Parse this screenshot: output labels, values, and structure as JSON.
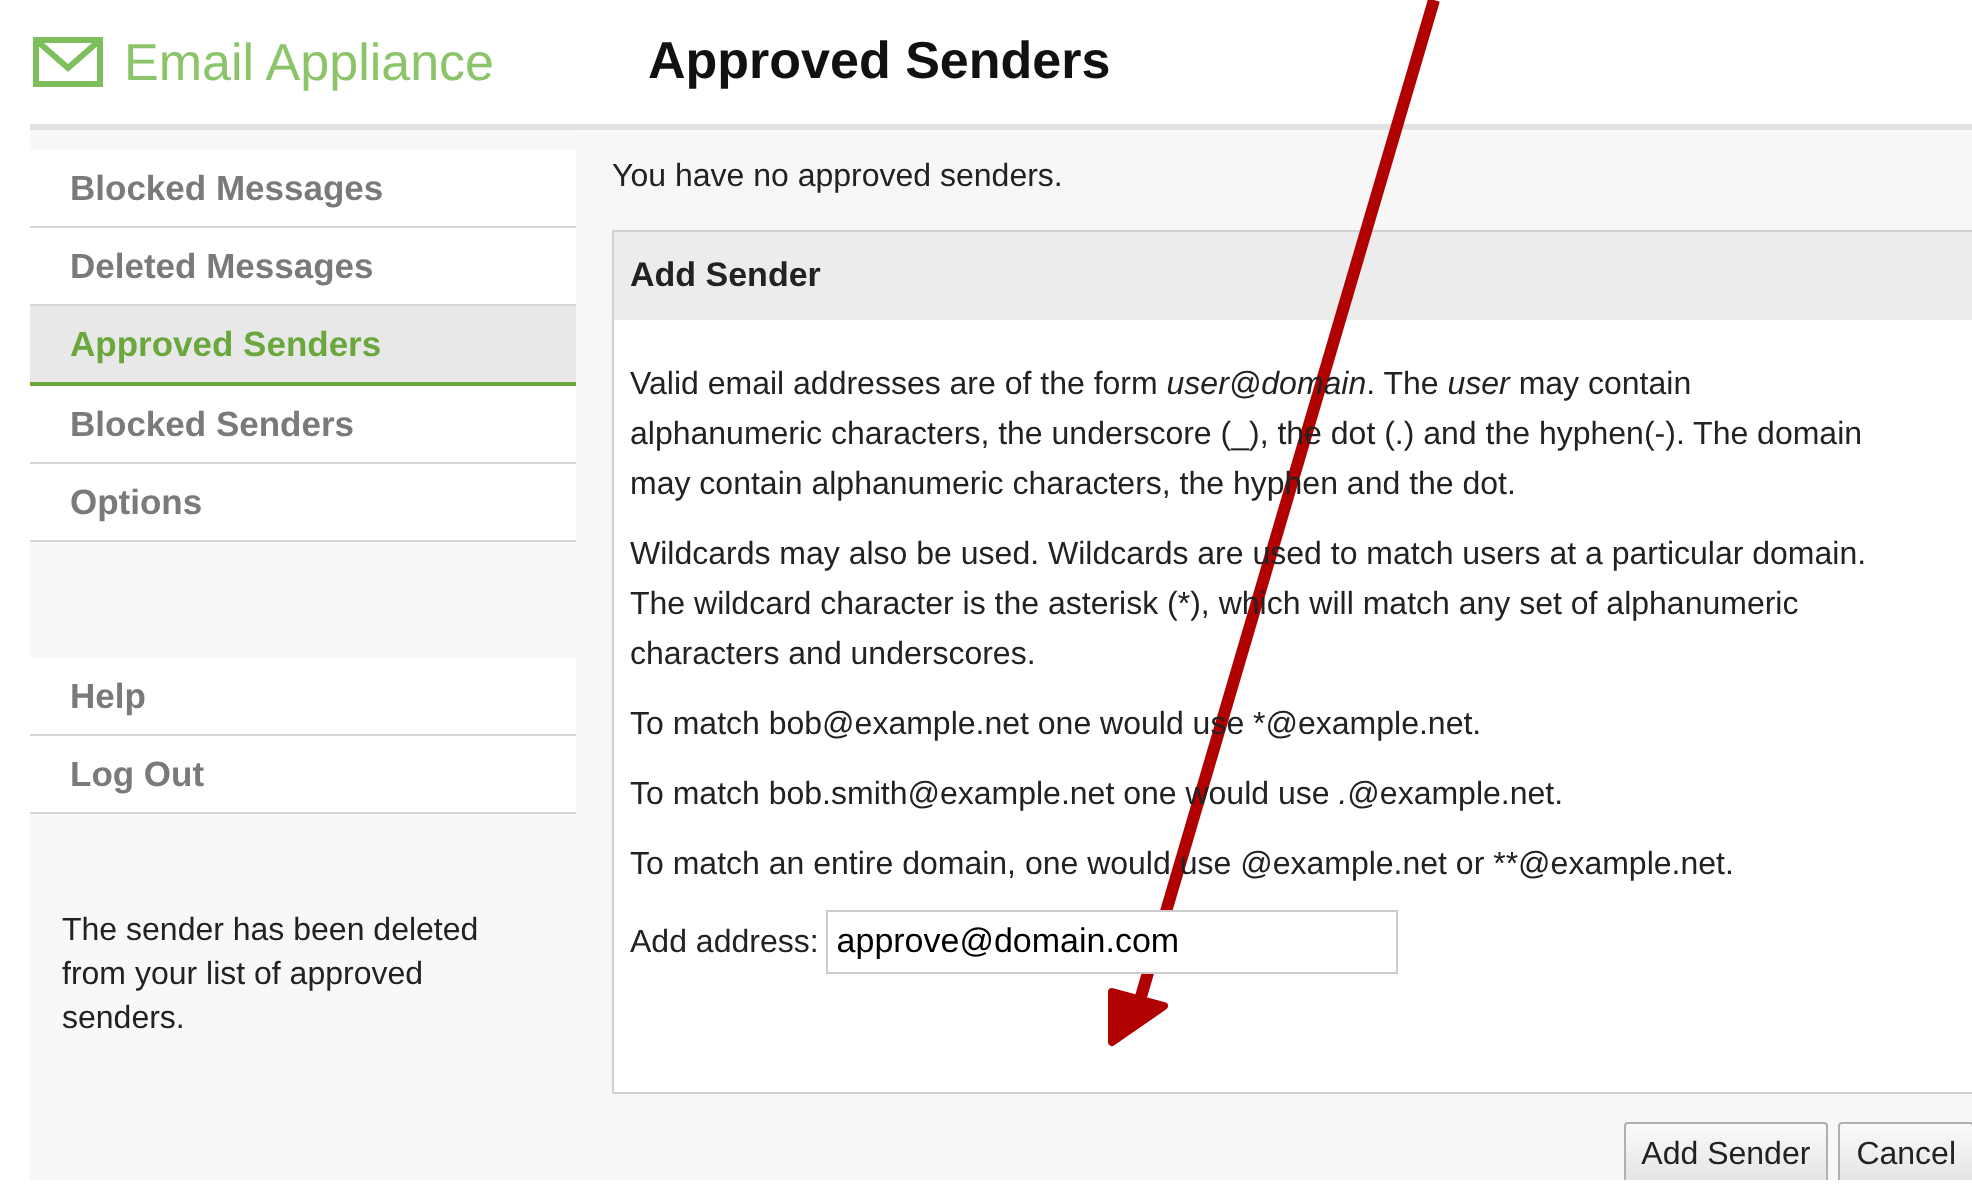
{
  "brand": "Email Appliance",
  "title": "Approved Senders",
  "sidebar": {
    "items": [
      {
        "label": "Blocked Messages",
        "selected": false
      },
      {
        "label": "Deleted Messages",
        "selected": false
      },
      {
        "label": "Approved Senders",
        "selected": true
      },
      {
        "label": "Blocked Senders",
        "selected": false
      },
      {
        "label": "Options",
        "selected": false
      }
    ],
    "bottom_items": [
      {
        "label": "Help",
        "selected": false
      },
      {
        "label": "Log Out",
        "selected": false
      }
    ],
    "message": "The sender has been deleted from your list of approved senders."
  },
  "status": "You have no approved senders.",
  "panel": {
    "title": "Add Sender",
    "paragraphs": [
      "Valid email addresses are of the form *user@domain*. The *user* may contain alphanumeric characters, the underscore (_), the dot (.) and the hyphen(-). The domain may contain alphanumeric characters, the hyphen and the dot.",
      "Wildcards may also be used. Wildcards are used to match users at a particular domain. The wildcard character is the asterisk (*), which will match any set of alphanumeric characters and underscores.",
      "To match bob@example.net one would use *@example.net.",
      "To match bob.smith@example.net one would use *.*@example.net.",
      "To match an entire domain, one would use @example.net or **@example.net."
    ],
    "field_label": "Add address:",
    "field_value": "approve@domain.com"
  },
  "buttons": [
    "Add Sender",
    "Cancel"
  ]
}
